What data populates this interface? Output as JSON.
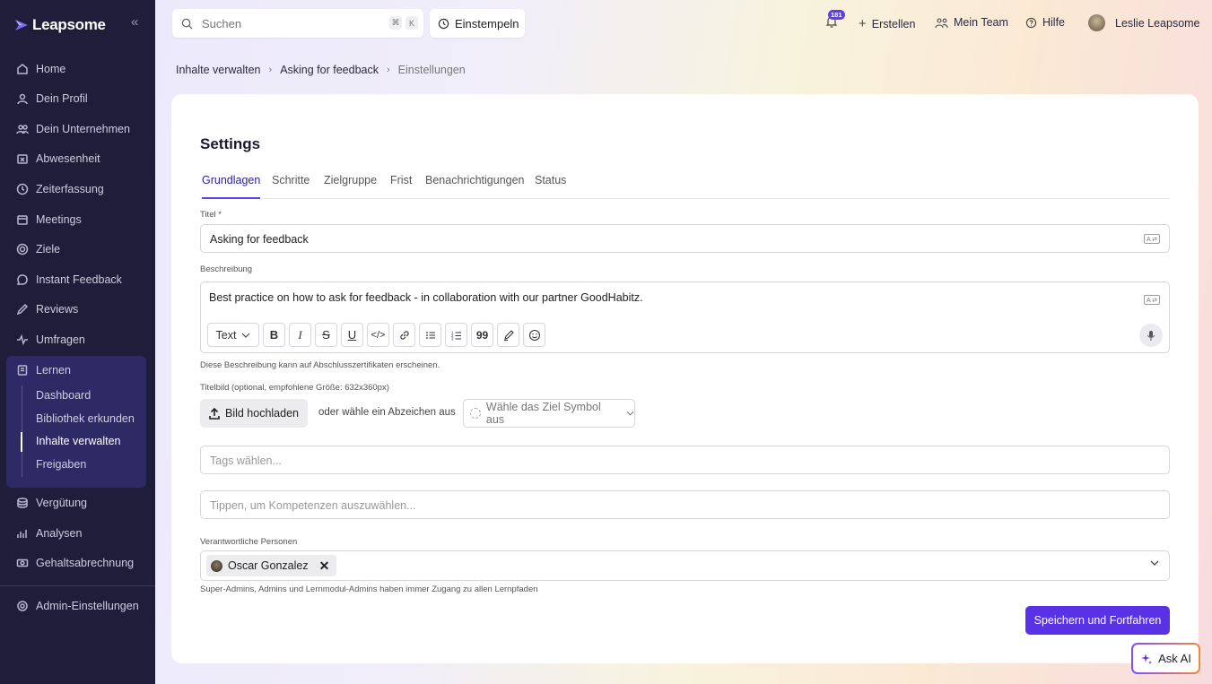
{
  "brand": {
    "name": "Leapsome"
  },
  "sidebar": {
    "items": [
      {
        "label": "Home"
      },
      {
        "label": "Dein Profil"
      },
      {
        "label": "Dein Unternehmen"
      },
      {
        "label": "Abwesenheit"
      },
      {
        "label": "Zeiterfassung"
      },
      {
        "label": "Meetings"
      },
      {
        "label": "Ziele"
      },
      {
        "label": "Instant Feedback"
      },
      {
        "label": "Reviews"
      },
      {
        "label": "Umfragen"
      },
      {
        "label": "Lernen"
      },
      {
        "label": "Vergütung"
      },
      {
        "label": "Analysen"
      },
      {
        "label": "Gehaltsabrechnung"
      },
      {
        "label": "Admin-Einstellungen"
      }
    ],
    "lernen_sub": [
      {
        "label": "Dashboard"
      },
      {
        "label": "Bibliothek erkunden"
      },
      {
        "label": "Inhalte verwalten"
      },
      {
        "label": "Freigaben"
      }
    ]
  },
  "topbar": {
    "search_placeholder": "Suchen",
    "kbd_cmd": "⌘",
    "kbd_k": "K",
    "clock_in": "Einstempeln",
    "notifications_count": "181",
    "create": "Erstellen",
    "my_team": "Mein Team",
    "help": "Hilfe",
    "user_name": "Leslie Leapsome"
  },
  "breadcrumb": {
    "items": [
      "Inhalte verwalten",
      "Asking for feedback",
      "Einstellungen"
    ]
  },
  "page": {
    "title": "Settings",
    "tabs": [
      "Grundlagen",
      "Schritte",
      "Zielgruppe",
      "Frist",
      "Benachrichtigungen",
      "Status"
    ]
  },
  "form": {
    "title_label": "Titel *",
    "title_value": "Asking for feedback",
    "description_label": "Beschreibung",
    "description_value": "Best practice on how to ask for feedback - in collaboration with our partner GoodHabitz.",
    "text_style": "Text",
    "description_help": "Diese Beschreibung kann auf Abschlusszertifikaten erscheinen.",
    "image_label": "Titelbild (optional, empfohlene Größe: 632x360px)",
    "upload_button": "Bild hochladen",
    "or_badge_text": "oder wähle ein Abzeichen aus",
    "symbol_placeholder": "Wähle das Ziel Symbol aus",
    "tags_placeholder": "Tags wählen...",
    "competencies_placeholder": "Tippen, um Kompetenzen auszuwählen...",
    "owners_label": "Verantwortliche Personen",
    "owners": [
      "Oscar Gonzalez"
    ],
    "owners_help": "Super-Admins, Admins und Lernmodul-Admins haben immer Zugang zu allen Lernpfaden",
    "save_button": "Speichern und Fortfahren"
  },
  "ask_ai": "Ask AI",
  "colors": {
    "sidebar_bg": "#1f1d3a",
    "sidebar_active_group": "#2e2a66",
    "accent": "#5a32e6"
  }
}
